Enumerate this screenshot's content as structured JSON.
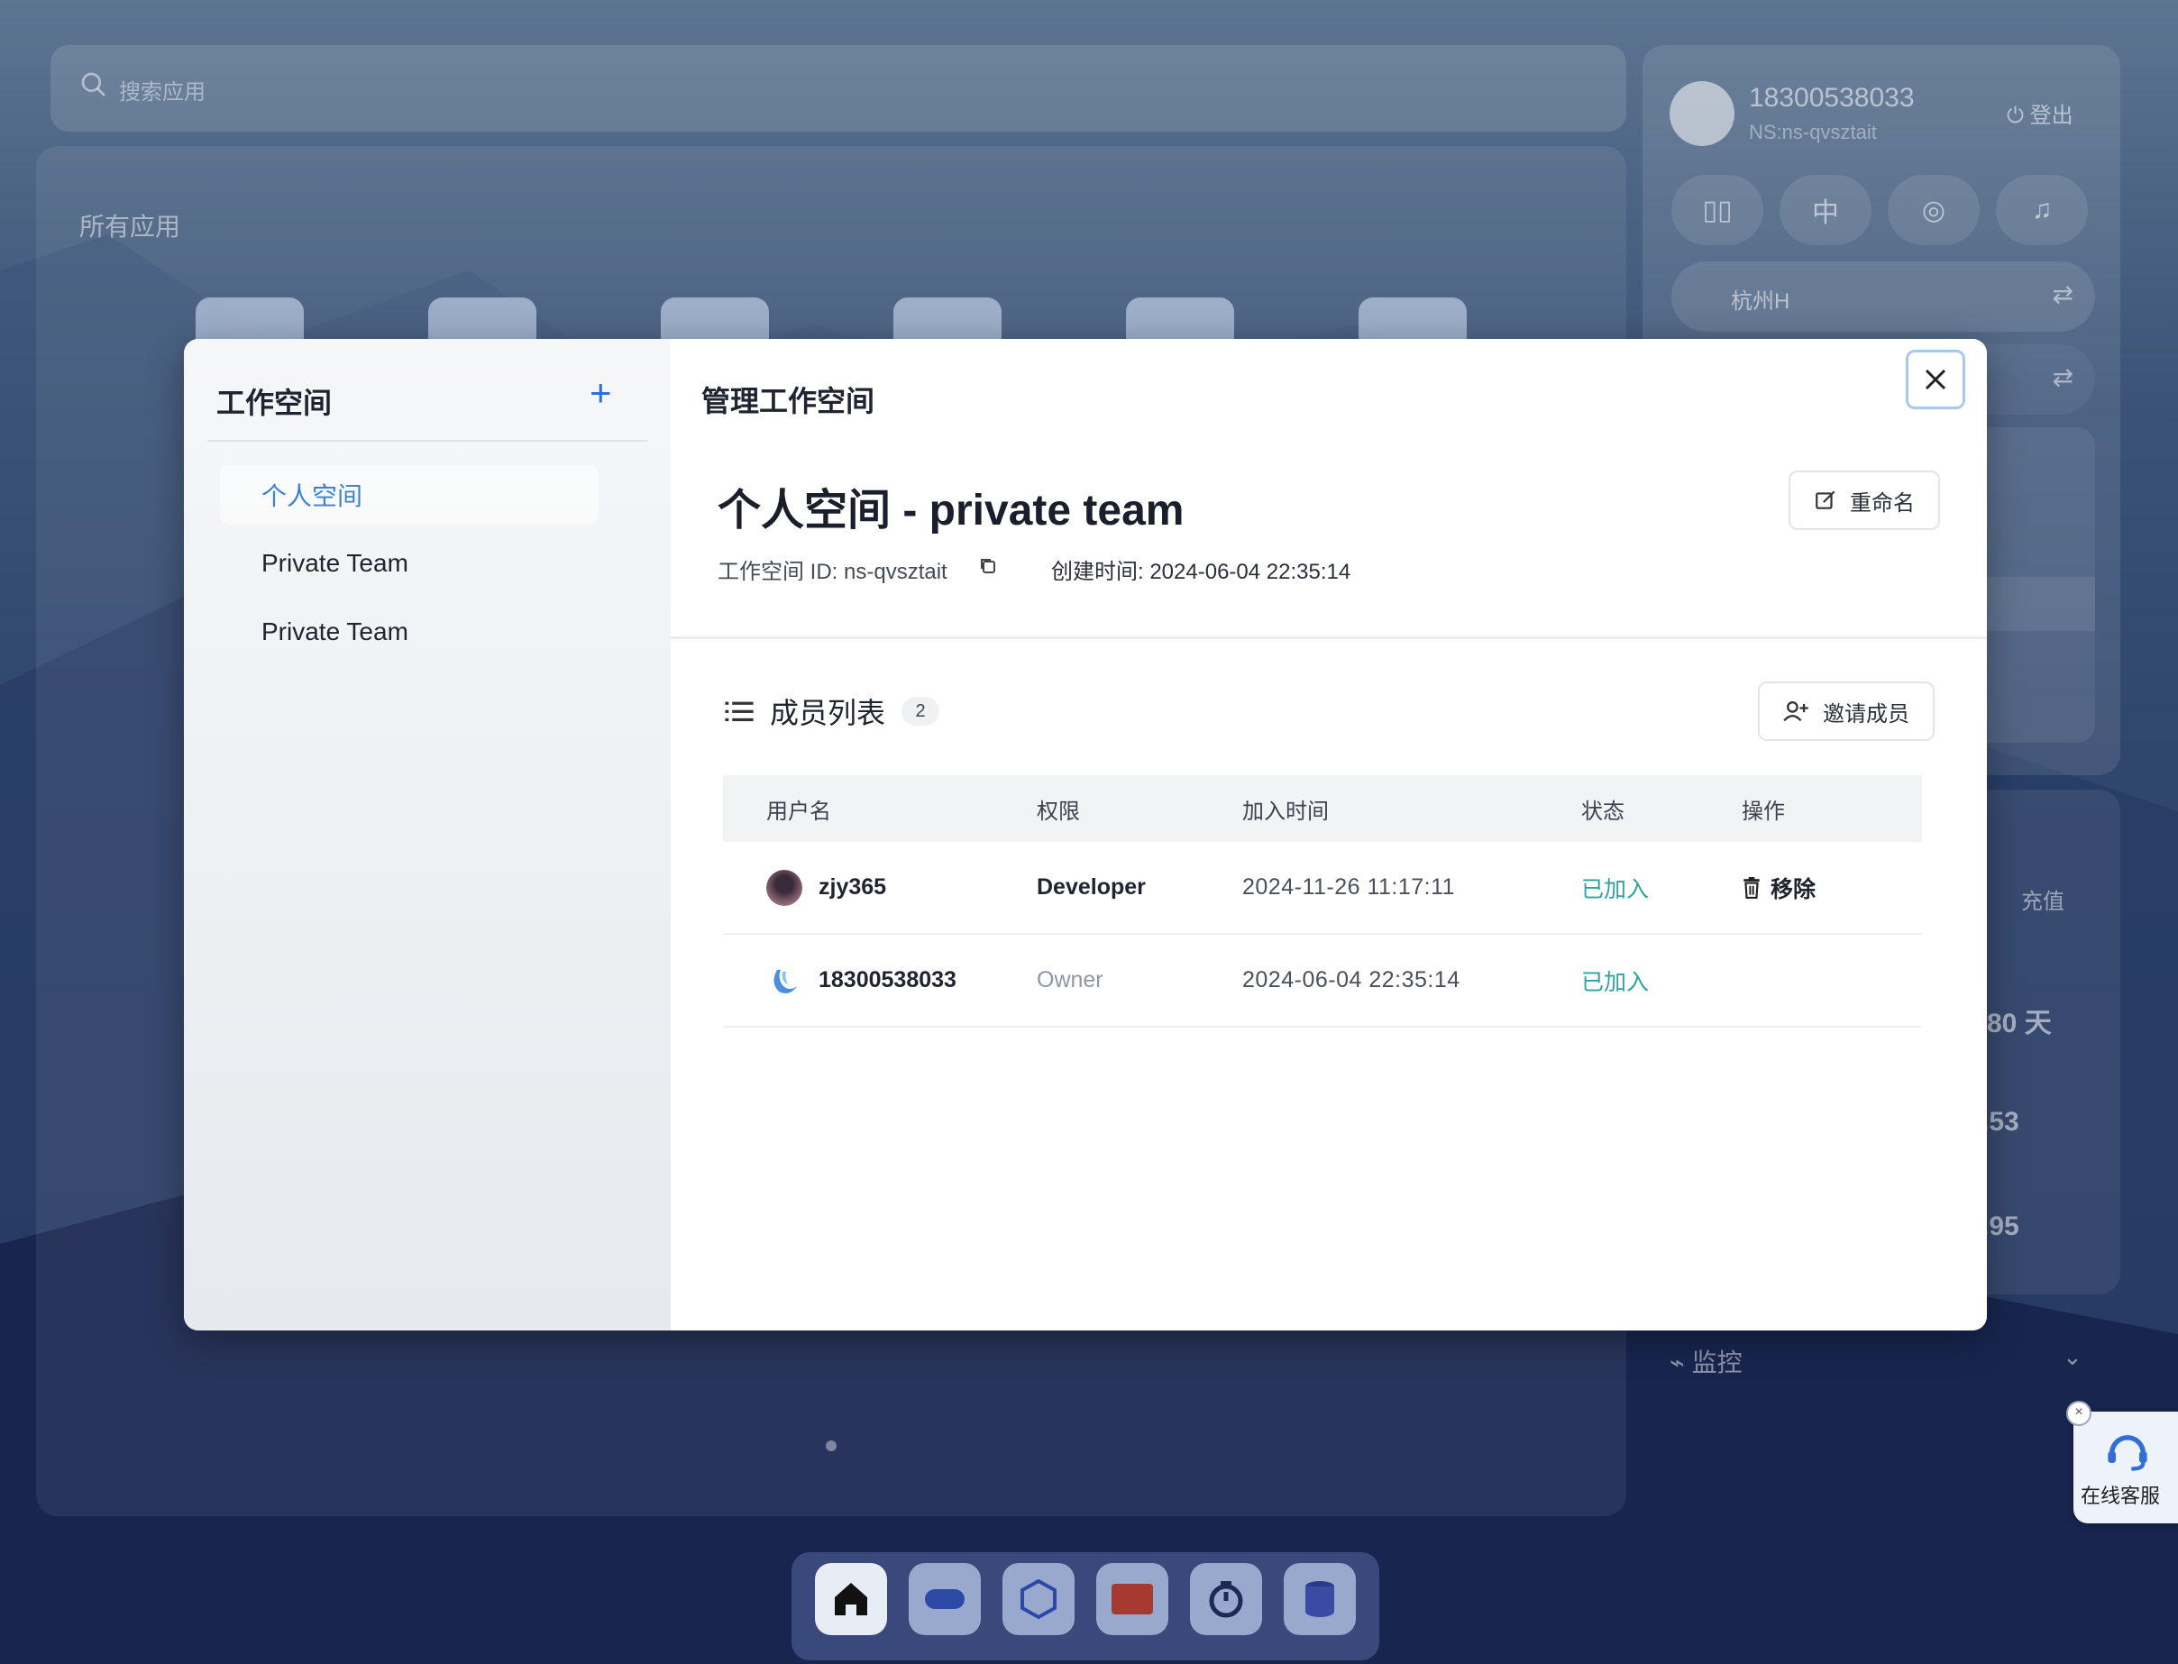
{
  "background": {
    "search_placeholder": "搜索应用",
    "apps_title": "所有应用",
    "user": {
      "phone": "18300538033",
      "ns": "NS:ns-qvsztait",
      "logout": "登出"
    },
    "quick_buttons": [
      "book-icon",
      "中",
      "github-icon",
      "bell-icon"
    ],
    "region": "杭州H",
    "recharge": "充值",
    "days": "80 天",
    "balance1": ".53",
    "balance2": ".95",
    "monitor": "监控",
    "support": "在线客服"
  },
  "sidebar": {
    "title": "工作空间",
    "items": [
      {
        "label": "个人空间",
        "active": true
      },
      {
        "label": "Private Team",
        "active": false
      },
      {
        "label": "Private Team",
        "active": false
      }
    ]
  },
  "modal": {
    "title": "管理工作空间",
    "workspace_name": "个人空间 - private team",
    "workspace_id_label": "工作空间 ID: ns-qvsztait",
    "created_label": "创建时间: 2024-06-04 22:35:14",
    "rename_label": "重命名",
    "member_list_label": "成员列表",
    "member_count": "2",
    "invite_label": "邀请成员",
    "columns": [
      "用户名",
      "权限",
      "加入时间",
      "状态",
      "操作"
    ],
    "members": [
      {
        "username": "zjy365",
        "role": "Developer",
        "joined": "2024-11-26 11:17:11",
        "status": "已加入",
        "action": "移除"
      },
      {
        "username": "18300538033",
        "role": "Owner",
        "joined": "2024-06-04 22:35:14",
        "status": "已加入",
        "action": ""
      }
    ]
  }
}
